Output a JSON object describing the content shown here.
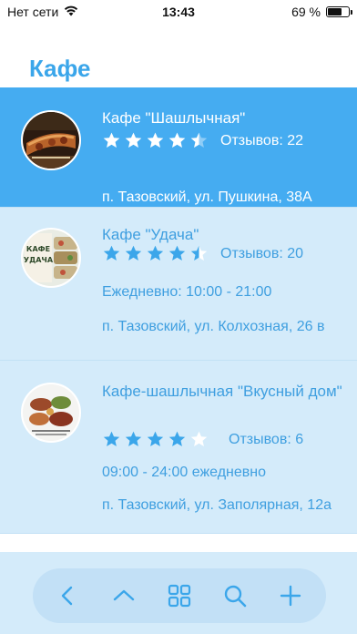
{
  "status_bar": {
    "carrier": "Нет сети",
    "time": "13:43",
    "battery_text": "69 %",
    "battery_level": 0.69
  },
  "header": {
    "title": "Кафе"
  },
  "cafes": [
    {
      "name": "Кафе \"Шашлычная\"",
      "rating": 4.5,
      "reviews": "Отзывов: 22",
      "hours": "",
      "address": "п. Тазовский, ул. Пушкина, 38А",
      "selected": true
    },
    {
      "name": "Кафе \"Удача\"",
      "rating": 4.5,
      "reviews": "Отзывов: 20",
      "hours": "Ежедневно: 10:00 - 21:00",
      "address": "п. Тазовский, ул. Колхозная, 26 в",
      "selected": false
    },
    {
      "name": "Кафе-шашлычная \"Вкусный дом\"",
      "rating": 4.0,
      "reviews": "Отзывов: 6",
      "hours": "09:00 - 24:00 ежедневно",
      "address": "п. Тазовский, ул. Заполярная, 12а",
      "selected": false
    }
  ],
  "thumb_text": {
    "udacha_line1": "КАФЕ",
    "udacha_line2": "УДАЧА"
  },
  "toolbar": {
    "buttons": [
      "back-icon",
      "chevron-up-icon",
      "grid-icon",
      "search-icon",
      "plus-icon"
    ]
  },
  "colors": {
    "accent": "#3ba6ea",
    "selected_bg": "#45acf1",
    "row_bg": "#d4ebfa",
    "toolbar_bg": "#c2e0f6",
    "star_empty_light": "#cfe8fa"
  }
}
